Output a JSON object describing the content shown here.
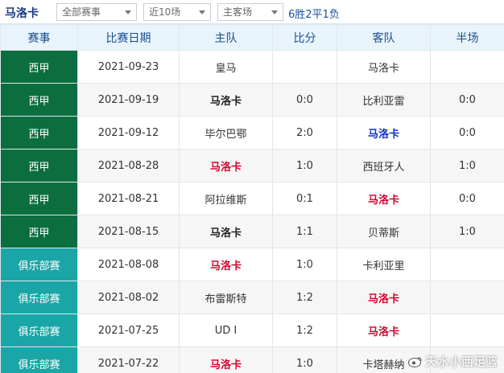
{
  "header": {
    "team_title": "马洛卡",
    "filters": [
      {
        "value": "全部赛事"
      },
      {
        "value": "近10场"
      },
      {
        "value": "主客场"
      }
    ],
    "summary": "6胜2平1负"
  },
  "table": {
    "columns": [
      "赛事",
      "比赛日期",
      "主队",
      "比分",
      "客队",
      "半场"
    ],
    "rows": [
      {
        "league": "西甲",
        "league_kind": "laliga",
        "date": "2021-09-23",
        "home": "皇马",
        "home_style": "",
        "score": "",
        "away": "马洛卡",
        "away_style": "",
        "half": ""
      },
      {
        "league": "西甲",
        "league_kind": "laliga",
        "date": "2021-09-19",
        "home": "马洛卡",
        "home_style": "hl-dark",
        "score": "0:0",
        "away": "比利亚雷",
        "away_style": "",
        "half": "0:0"
      },
      {
        "league": "西甲",
        "league_kind": "laliga",
        "date": "2021-09-12",
        "home": "毕尔巴鄂",
        "home_style": "",
        "score": "2:0",
        "away": "马洛卡",
        "away_style": "hl-blue",
        "half": "0:0"
      },
      {
        "league": "西甲",
        "league_kind": "laliga",
        "date": "2021-08-28",
        "home": "马洛卡",
        "home_style": "hl-red",
        "score": "1:0",
        "away": "西班牙人",
        "away_style": "",
        "half": "1:0"
      },
      {
        "league": "西甲",
        "league_kind": "laliga",
        "date": "2021-08-21",
        "home": "阿拉维斯",
        "home_style": "",
        "score": "0:1",
        "away": "马洛卡",
        "away_style": "hl-red",
        "half": "0:0"
      },
      {
        "league": "西甲",
        "league_kind": "laliga",
        "date": "2021-08-15",
        "home": "马洛卡",
        "home_style": "hl-dark",
        "score": "1:1",
        "away": "贝蒂斯",
        "away_style": "",
        "half": "1:0"
      },
      {
        "league": "俱乐部赛",
        "league_kind": "club",
        "date": "2021-08-08",
        "home": "马洛卡",
        "home_style": "hl-red",
        "score": "1:0",
        "away": "卡利亚里",
        "away_style": "",
        "half": ""
      },
      {
        "league": "俱乐部赛",
        "league_kind": "club",
        "date": "2021-08-02",
        "home": "布雷斯特",
        "home_style": "",
        "score": "1:2",
        "away": "马洛卡",
        "away_style": "hl-red",
        "half": ""
      },
      {
        "league": "俱乐部赛",
        "league_kind": "club",
        "date": "2021-07-25",
        "home": "UD I",
        "home_style": "",
        "score": "1:2",
        "away": "马洛卡",
        "away_style": "hl-red",
        "half": ""
      },
      {
        "league": "俱乐部赛",
        "league_kind": "club",
        "date": "2021-07-22",
        "home": "马洛卡",
        "home_style": "hl-red",
        "score": "1:0",
        "away": "卡塔赫纳",
        "away_style": "",
        "half": ""
      }
    ]
  },
  "watermark": "天水小西足篮",
  "colors": {
    "laliga": "#0c6e3f",
    "club": "#1aa6a6",
    "win_red": "#d4082e",
    "draw_blue": "#1133cc",
    "header_text": "#1a4d8f"
  }
}
